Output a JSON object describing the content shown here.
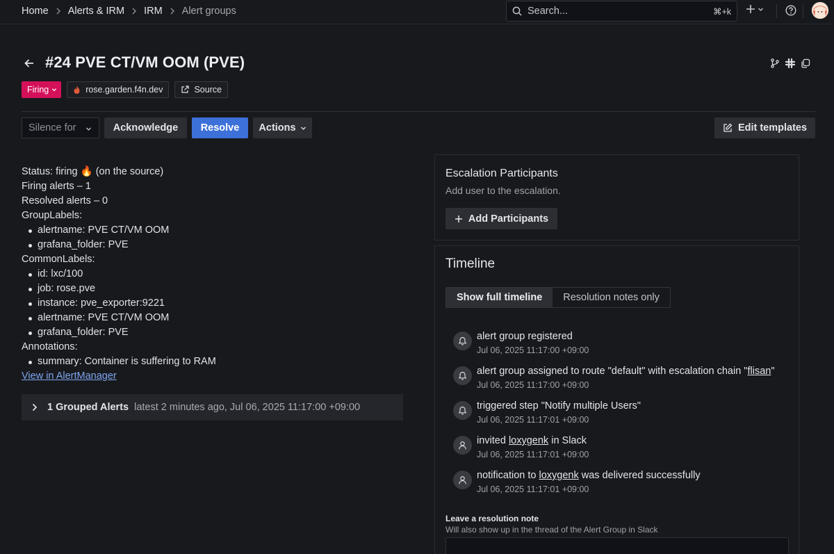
{
  "breadcrumbs": [
    "Home",
    "Alerts & IRM",
    "IRM",
    "Alert groups"
  ],
  "search": {
    "placeholder": "Search...",
    "shortcut": "⌘+k"
  },
  "header": {
    "title": "#24 PVE CT/VM OOM (PVE)",
    "status_tag": "Firing",
    "integration_tag": "rose.garden.f4n.dev",
    "source_tag": "Source"
  },
  "actions": {
    "silence": "Silence for",
    "acknowledge": "Acknowledge",
    "resolve": "Resolve",
    "actions": "Actions",
    "edit_templates": "Edit templates"
  },
  "details": {
    "status_line": "Status: firing 🔥 (on the source)",
    "firing_alerts": "Firing alerts – 1",
    "resolved_alerts": "Resolved alerts – 0",
    "group_labels_heading": "GroupLabels:",
    "group_labels": [
      "alertname: PVE CT/VM OOM",
      "grafana_folder: PVE"
    ],
    "common_labels_heading": "CommonLabels:",
    "common_labels": [
      "id: lxc/100",
      "job: rose.pve",
      "instance: pve_exporter:9221",
      "alertname: PVE CT/VM OOM",
      "grafana_folder: PVE"
    ],
    "annotations_heading": "Annotations:",
    "annotations": [
      "summary: Container is suffering to RAM"
    ],
    "alertmanager_link": "View in AlertManager"
  },
  "grouped": {
    "title": "1 Grouped Alerts",
    "meta": "latest 2 minutes ago,  Jul 06, 2025 11:17:00 +09:00"
  },
  "escalation": {
    "title": "Escalation Participants",
    "subtitle": "Add user to the escalation.",
    "add_button": "Add Participants"
  },
  "timeline": {
    "title": "Timeline",
    "tabs": [
      "Show full timeline",
      "Resolution notes only"
    ],
    "events": [
      {
        "icon": "bell-icon",
        "pre": "alert group registered",
        "link": "",
        "post": "",
        "time": "Jul 06, 2025 11:17:00 +09:00"
      },
      {
        "icon": "bell-icon",
        "pre": "alert group assigned to route \"default\" with escalation chain \"",
        "link": "flisan",
        "post": "\"",
        "time": "Jul 06, 2025 11:17:00 +09:00"
      },
      {
        "icon": "bell-icon",
        "pre": "triggered step \"Notify multiple Users\"",
        "link": "",
        "post": "",
        "time": "Jul 06, 2025 11:17:01 +09:00"
      },
      {
        "icon": "user-icon",
        "pre": "invited ",
        "link": "loxygenk",
        "post": " in Slack",
        "time": "Jul 06, 2025 11:17:01 +09:00"
      },
      {
        "icon": "user-icon",
        "pre": "notification to ",
        "link": "loxygenk",
        "post": " was delivered successfully",
        "time": "Jul 06, 2025 11:17:01 +09:00"
      }
    ],
    "note_label": "Leave a resolution note",
    "note_sub": "Will also show up in the thread of the Alert Group in Slack"
  },
  "colors": {
    "firing": "#d5105b",
    "primary": "#3d71d9",
    "link": "#7ea6f0",
    "background": "#18191d"
  }
}
